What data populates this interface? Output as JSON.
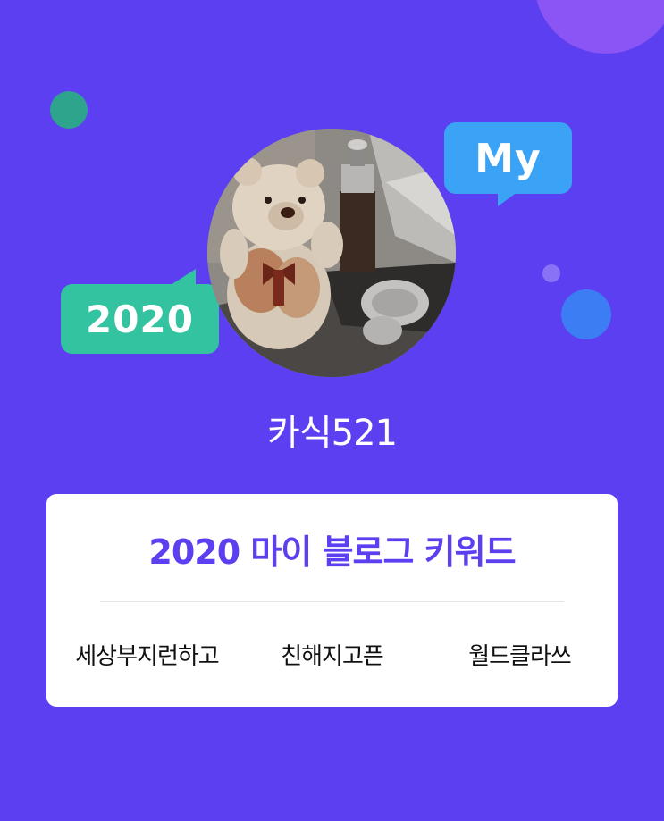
{
  "decor": {
    "my_bubble": "My",
    "year_bubble": "2020",
    "colors": {
      "background": "#5b3ff0",
      "my_bubble": "#3ba3f5",
      "year_bubble": "#34c3a0",
      "accent_title": "#5b3ff0"
    }
  },
  "profile": {
    "avatar_icon": "profile-photo-teddy-bear",
    "username": "카식521"
  },
  "keywords_card": {
    "title": "2020 마이 블로그 키워드",
    "items": [
      "세상부지런하고",
      "친해지고픈",
      "월드클라쓰"
    ]
  }
}
